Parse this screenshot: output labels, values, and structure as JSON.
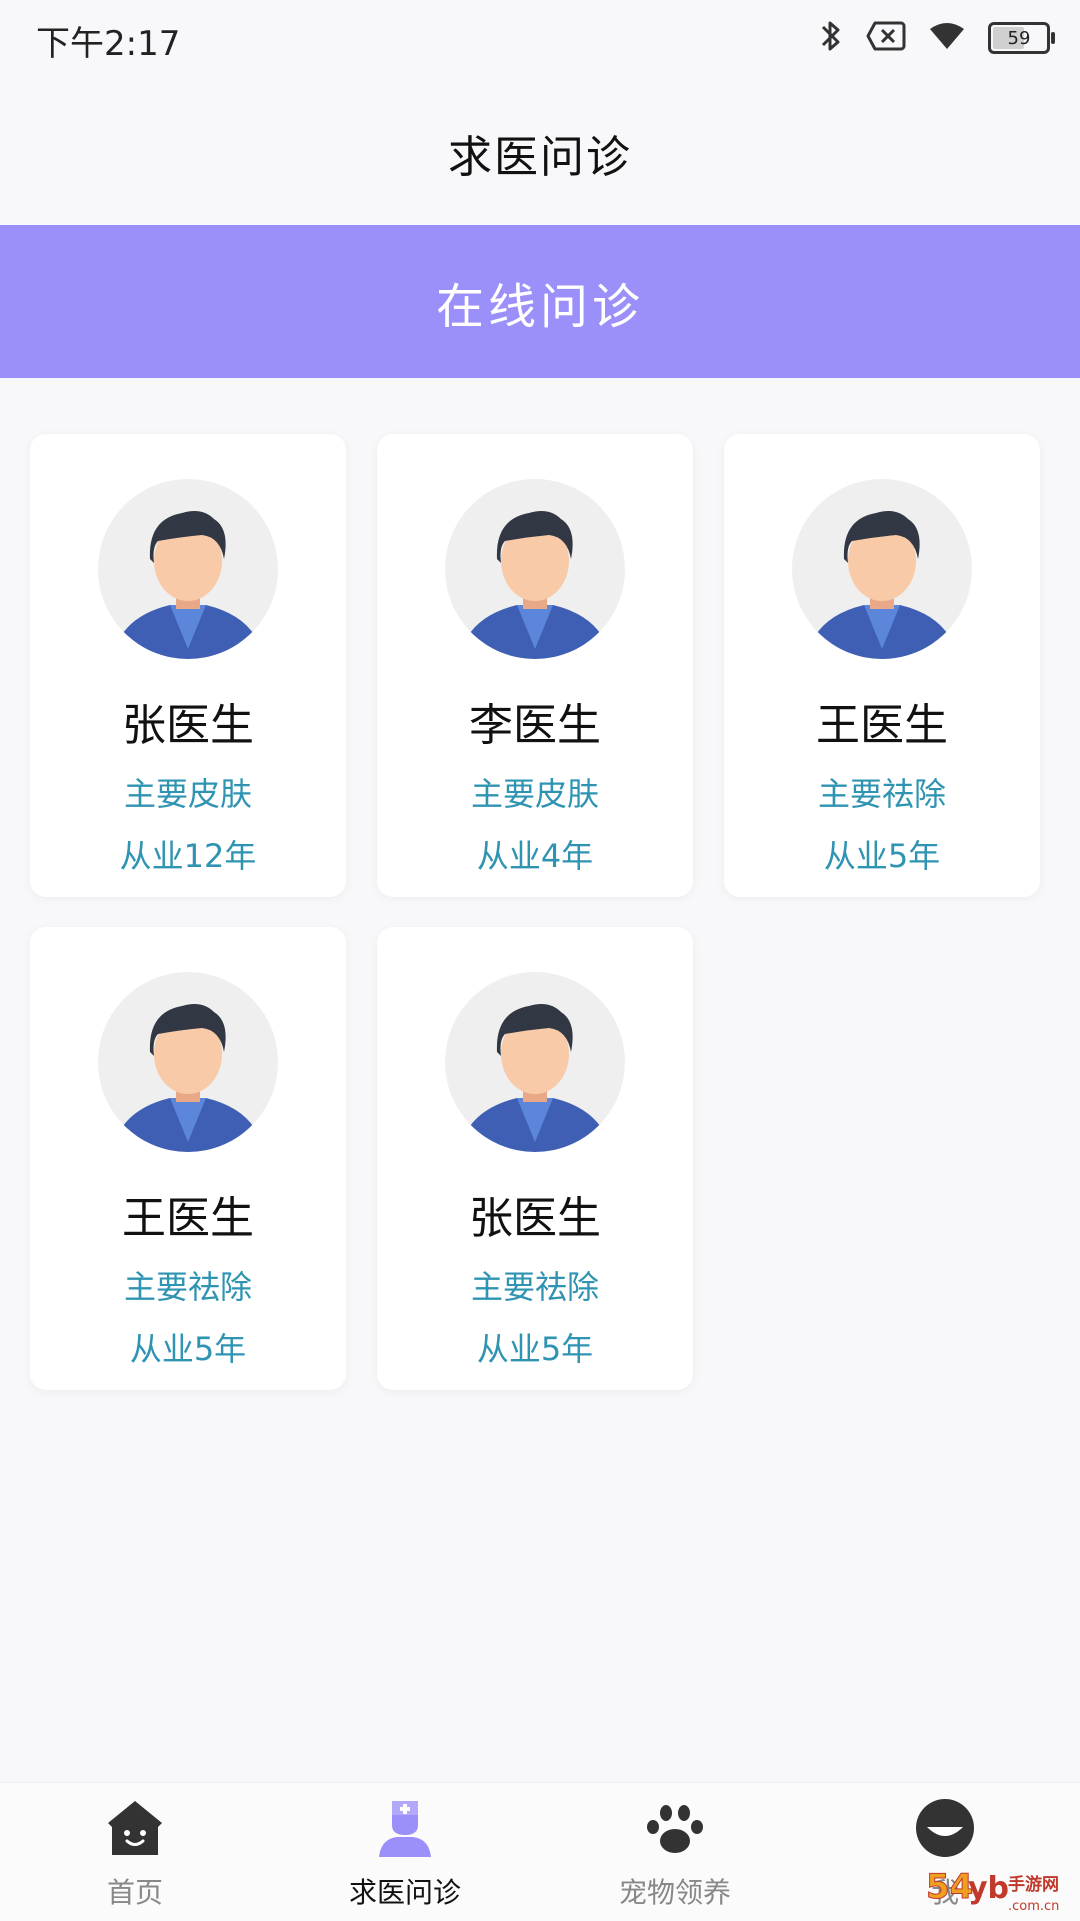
{
  "status_bar": {
    "time": "下午2:17",
    "battery": "59",
    "icons": [
      "bluetooth-icon",
      "sim-off-icon",
      "wifi-icon",
      "battery-icon"
    ]
  },
  "header": {
    "title": "求医问诊"
  },
  "banner": {
    "title": "在线问诊",
    "color": "#9b8ff9"
  },
  "doctors": [
    {
      "name": "张医生",
      "specialty": "主要皮肤",
      "years": "从业12年"
    },
    {
      "name": "李医生",
      "specialty": "主要皮肤",
      "years": "从业4年"
    },
    {
      "name": "王医生",
      "specialty": "主要祛除",
      "years": "从业5年"
    },
    {
      "name": "王医生",
      "specialty": "主要祛除",
      "years": "从业5年"
    },
    {
      "name": "张医生",
      "specialty": "主要祛除",
      "years": "从业5年"
    }
  ],
  "tab_bar": {
    "tabs": [
      {
        "label": "首页",
        "icon": "home-icon",
        "active": false
      },
      {
        "label": "求医问诊",
        "icon": "doctor-icon",
        "active": true
      },
      {
        "label": "宠物领养",
        "icon": "paw-icon",
        "active": false
      },
      {
        "label": "我",
        "icon": "profile-icon",
        "active": false
      }
    ]
  },
  "watermark": {
    "text": "54yb手游网",
    "subtext": ".com.cn"
  },
  "colors": {
    "accent": "#9b8ff9",
    "info_text": "#2f94b2"
  }
}
